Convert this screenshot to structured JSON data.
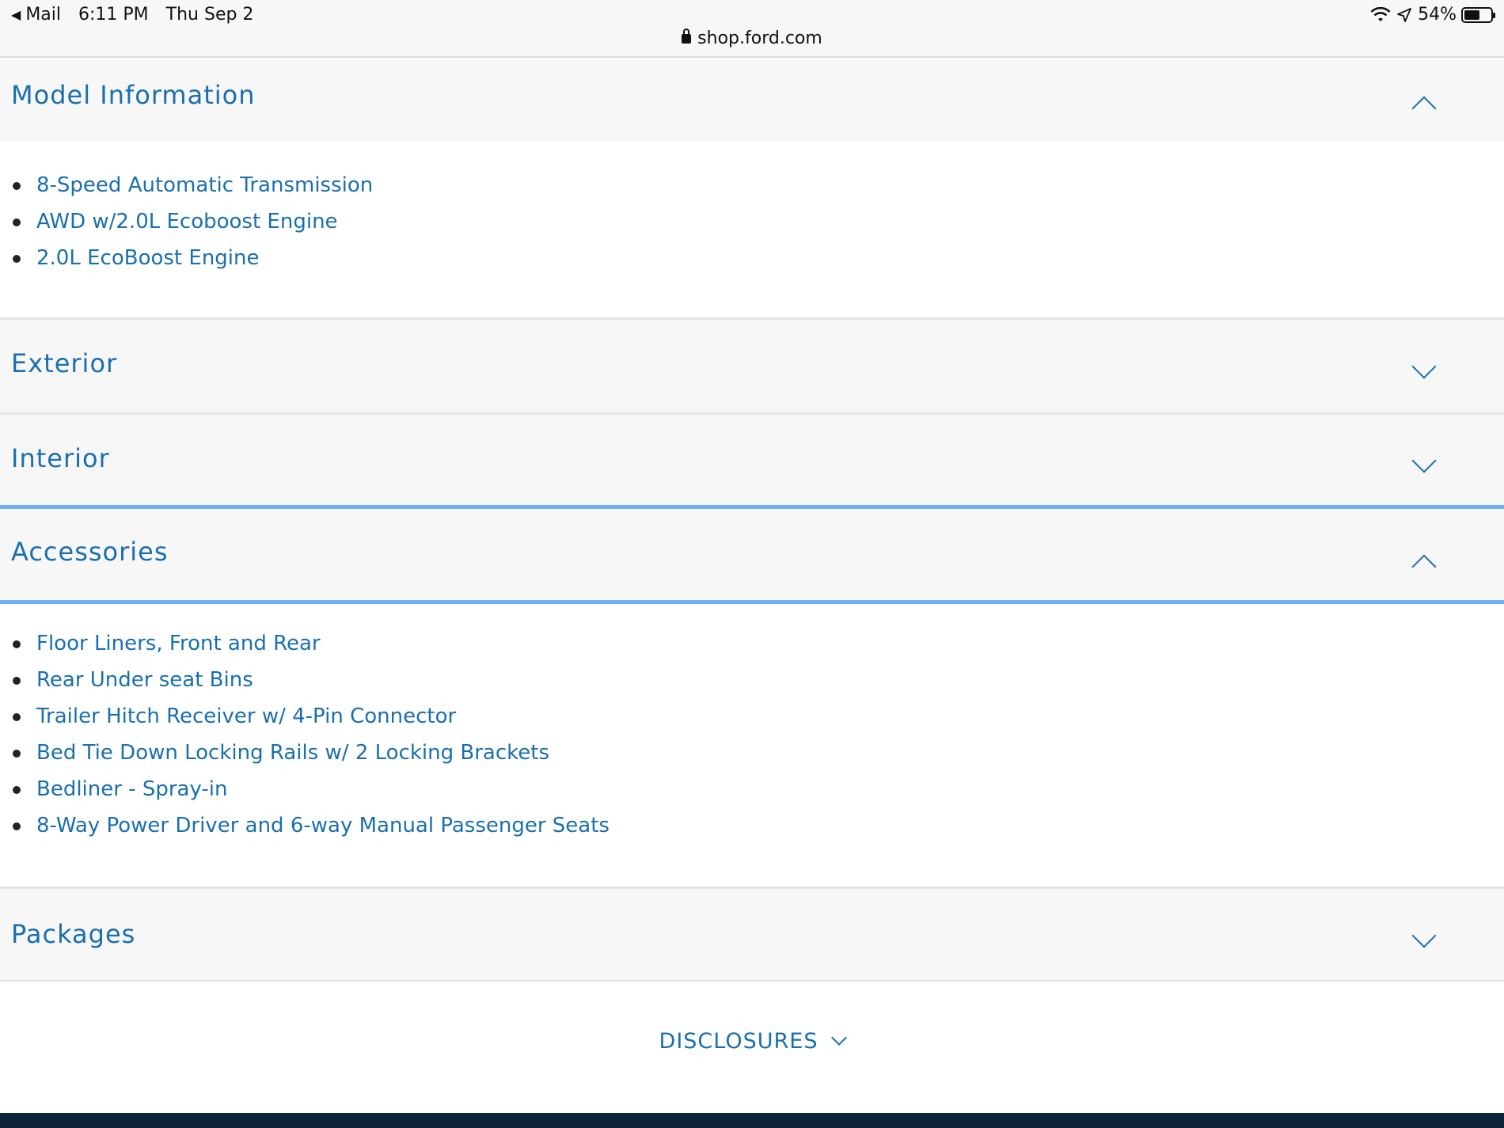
{
  "status_bar": {
    "back_app": "Mail",
    "time": "6:11 PM",
    "date": "Thu Sep 2",
    "battery": "54%",
    "url": "shop.ford.com"
  },
  "sections": {
    "model": {
      "title": "Model Information",
      "expanded": true,
      "items": [
        "8-Speed Automatic Transmission",
        "AWD w/2.0L Ecoboost Engine",
        "2.0L EcoBoost Engine"
      ]
    },
    "exterior": {
      "title": "Exterior",
      "expanded": false
    },
    "interior": {
      "title": "Interior",
      "expanded": false
    },
    "accessories": {
      "title": "Accessories",
      "expanded": true,
      "items": [
        "Floor Liners, Front and Rear",
        "Rear Under seat Bins",
        "Trailer Hitch Receiver w/ 4-Pin Connector",
        "Bed Tie Down Locking Rails w/ 2 Locking Brackets",
        "Bedliner - Spray-in",
        "8-Way Power Driver and 6-way Manual Passenger Seats"
      ]
    },
    "packages": {
      "title": "Packages",
      "expanded": false
    }
  },
  "disclosures_label": "DISCLOSURES",
  "colors": {
    "link": "#1a6fae",
    "accent": "#6eaef2",
    "footer": "#0d2339",
    "section_bg": "#f7f7f8"
  },
  "icons": [
    "chevron-up-icon",
    "chevron-down-icon",
    "lock-icon",
    "wifi-icon",
    "location-icon",
    "battery-icon"
  ]
}
